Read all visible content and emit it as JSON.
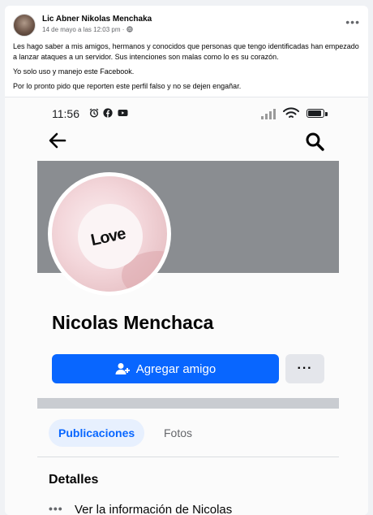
{
  "post": {
    "author": "Lic Abner Nikolas Menchaka",
    "meta": "14 de mayo a las 12:03 pm ·",
    "paragraphs": [
      "Les hago saber a mis amigos, hermanos y conocidos que personas que tengo identificadas han empezado a lanzar ataques a un servidor. Sus intenciones son malas como lo es su corazón.",
      "Yo solo uso y manejo este Facebook.",
      "Por lo pronto pido que reporten este perfil falso y no se dejen engañar."
    ]
  },
  "screenshot": {
    "status": {
      "time": "11:56"
    },
    "profile": {
      "picture_text": "Love",
      "name": "Nicolas Menchaca",
      "add_friend_label": "Agregar amigo",
      "more_label": "···"
    },
    "tabs": [
      {
        "label": "Publicaciones",
        "active": true
      },
      {
        "label": "Fotos",
        "active": false
      }
    ],
    "details": {
      "heading": "Detalles",
      "info_label": "Ver la información de Nicolas"
    }
  },
  "colors": {
    "brand_blue": "#0866ff",
    "cover_gray": "#8a8d91",
    "tab_bg": "#e7f0fe"
  },
  "icons": [
    "more-icon",
    "globe-icon",
    "back-arrow-icon",
    "search-icon",
    "add-friend-icon",
    "alarm-icon",
    "facebook-icon",
    "youtube-icon",
    "wifi-icon",
    "battery-icon"
  ]
}
